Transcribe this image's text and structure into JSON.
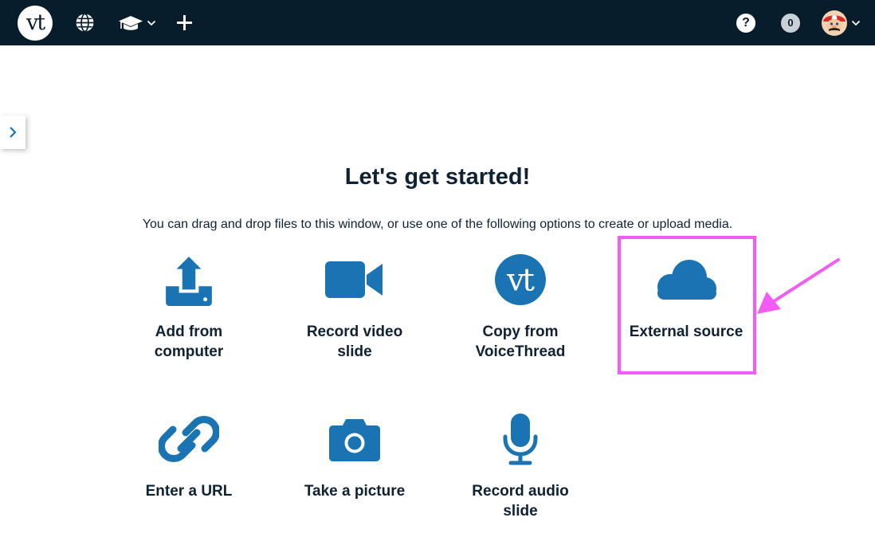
{
  "topbar": {
    "logo_text": "vt",
    "icons": [
      "globe-icon",
      "graduation-cap-icon",
      "chevron-down-icon",
      "plus-icon"
    ],
    "help_label": "?",
    "notification_count": "0",
    "colors": {
      "bar": "#071d2c",
      "accent": "#1a73b3"
    }
  },
  "main": {
    "title": "Let's get started!",
    "subtitle": "You can drag and drop files to this window, or use one of the following options to create or upload media.",
    "options": [
      {
        "label_line1": "Add from",
        "label_line2": "computer",
        "icon": "upload-icon"
      },
      {
        "label_line1": "Record video",
        "label_line2": "slide",
        "icon": "video-camera-icon"
      },
      {
        "label_line1": "Copy from",
        "label_line2": "VoiceThread",
        "icon": "voicethread-logo-icon"
      },
      {
        "label_line1": "External source",
        "label_line2": "",
        "icon": "cloud-icon"
      },
      {
        "label_line1": "Enter a URL",
        "label_line2": "",
        "icon": "link-icon"
      },
      {
        "label_line1": "Take a picture",
        "label_line2": "",
        "icon": "camera-icon"
      },
      {
        "label_line1": "Record audio",
        "label_line2": "slide",
        "icon": "microphone-icon"
      }
    ],
    "annotation_color": "#f25cf4"
  }
}
